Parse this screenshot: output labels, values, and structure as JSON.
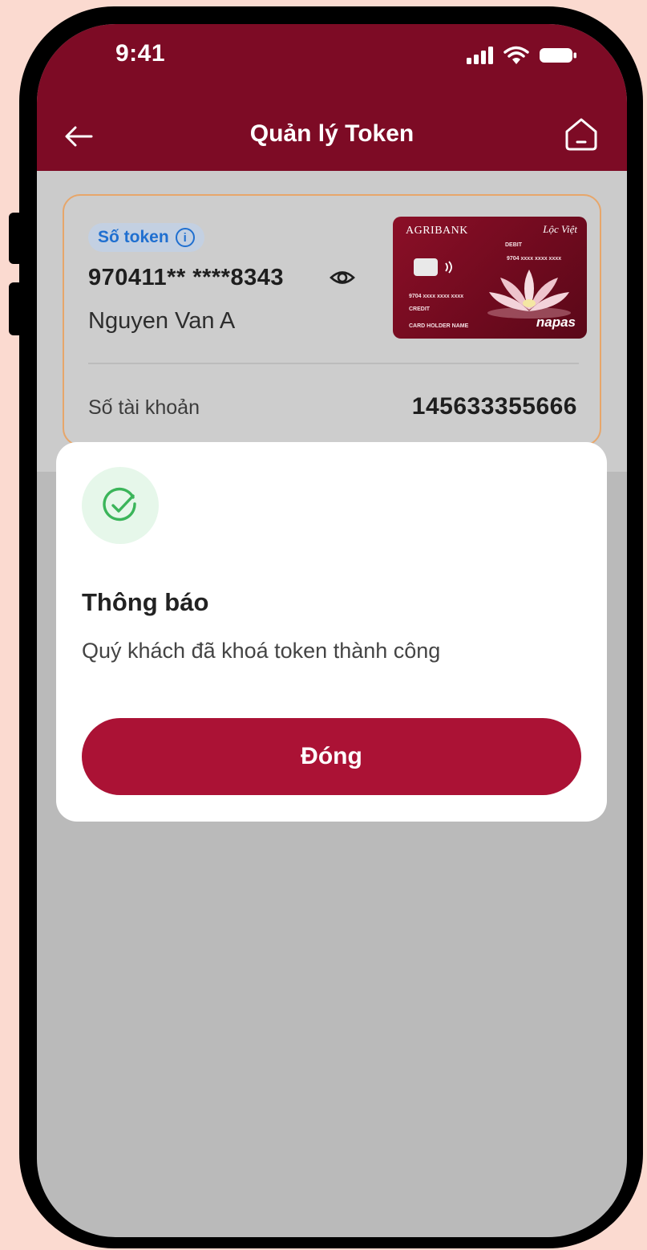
{
  "status_bar": {
    "time": "9:41",
    "icons": [
      "signal-icon",
      "wifi-icon",
      "battery-icon"
    ]
  },
  "header": {
    "title": "Quản lý Token",
    "back_icon": "arrow-left-icon",
    "home_icon": "home-icon"
  },
  "token_card": {
    "badge_label": "Số token",
    "badge_icon": "info-icon",
    "token_number": "970411** ****8343",
    "eye_icon": "eye-icon",
    "holder_name": "Nguyen Van A",
    "account_label": "Số tài khoản",
    "account_number": "145633355666",
    "bank_card": {
      "bank": "AGRIBANK",
      "brand": "Lộc Việt",
      "debit": "DEBIT",
      "credit": "CREDIT",
      "number_top": "9704  xxxx  xxxx  xxxx",
      "number_mid": "9704  xxxx  xxxx  xxxx",
      "holder": "CARD HOLDER NAME",
      "network": "napas"
    }
  },
  "dialog": {
    "icon": "check-circle-icon",
    "title": "Thông báo",
    "message": "Quý khách đã khoá token thành công",
    "button_label": "Đóng"
  },
  "colors": {
    "header_bg": "#7d0b25",
    "button_bg": "#ab1235",
    "badge_text": "#1f6fd0",
    "success": "#3bb55a",
    "card_border": "#e7a66a"
  }
}
